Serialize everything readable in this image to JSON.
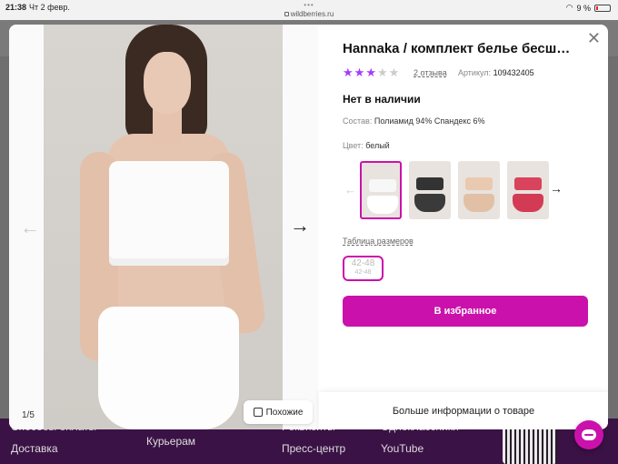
{
  "statusbar": {
    "time": "21:38",
    "date": "Чт 2 февр.",
    "url": "wildberries.ru",
    "battery": "9 %"
  },
  "footer": {
    "col1": [
      "Способы оплаты",
      "Доставка"
    ],
    "col2": [
      "Курьерам"
    ],
    "col3": [
      "Реквизиты",
      "Пресс-центр"
    ],
    "col4": [
      "Одноклассники",
      "YouTube"
    ]
  },
  "gallery": {
    "counter": "1/5",
    "similar_label": "Похожие"
  },
  "product": {
    "title": "Hannaka / комплект белье бесш…",
    "rating": 3,
    "rating_max": 5,
    "reviews": "2 отзыва",
    "article_label": "Артикул:",
    "article": "109432405",
    "stock": "Нет в наличии",
    "composition_label": "Состав:",
    "composition": "Полиамид 94% Спандекс 6%",
    "color_label": "Цвет:",
    "color": "белый",
    "size_table_label": "Таблица размеров",
    "size_main": "42-48",
    "size_sub": "42-48",
    "favorite_label": "В избранное",
    "more_info_label": "Больше информации о товаре"
  },
  "colors": {
    "accent": "#cb11ab",
    "star": "#a73afd"
  },
  "thumbs": [
    {
      "bra": "#f7f7f7",
      "briefs": "#ffffff",
      "active": true
    },
    {
      "bra": "#333333",
      "briefs": "#3a3a3a",
      "active": false
    },
    {
      "bra": "#e9c9b0",
      "briefs": "#e2c0a6",
      "active": false
    },
    {
      "bra": "#d9435b",
      "briefs": "#d33b55",
      "active": false
    }
  ]
}
